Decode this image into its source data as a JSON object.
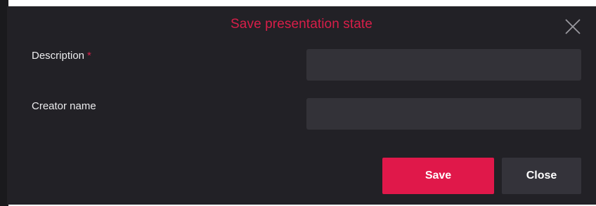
{
  "dialog": {
    "title": "Save presentation state",
    "close_icon": "close-icon"
  },
  "form": {
    "description": {
      "label": "Description",
      "required_mark": "*",
      "value": ""
    },
    "creator_name": {
      "label": "Creator name",
      "value": ""
    }
  },
  "buttons": {
    "save_label": "Save",
    "close_label": "Close"
  },
  "colors": {
    "accent": "#d81e49",
    "dialog_background": "#222126",
    "input_background": "#333238",
    "secondary_button": "#34333a"
  }
}
